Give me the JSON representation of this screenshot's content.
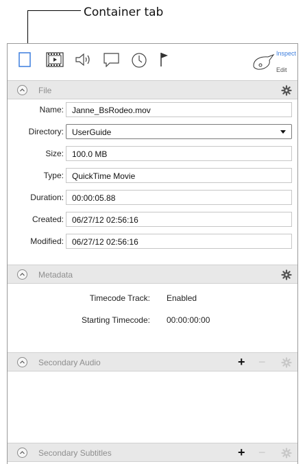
{
  "callout": {
    "label": "Container tab"
  },
  "toolbar": {
    "tabs": [
      {
        "name": "container-tab-icon"
      },
      {
        "name": "video-tab-icon"
      },
      {
        "name": "audio-tab-icon"
      },
      {
        "name": "subtitles-tab-icon"
      },
      {
        "name": "timing-tab-icon"
      },
      {
        "name": "markers-tab-icon"
      }
    ],
    "inspect_label": "Inspect",
    "edit_label": "Edit",
    "accent_color": "#3b7ddd"
  },
  "file_section": {
    "title": "File",
    "fields": [
      {
        "label": "Name:",
        "value": "Janne_BsRodeo.mov"
      },
      {
        "label": "Directory:",
        "value": "UserGuide"
      },
      {
        "label": "Size:",
        "value": "100.0 MB"
      },
      {
        "label": "Type:",
        "value": "QuickTime Movie"
      },
      {
        "label": "Duration:",
        "value": "00:00:05.88"
      },
      {
        "label": "Created:",
        "value": "06/27/12 02:56:16"
      },
      {
        "label": "Modified:",
        "value": "06/27/12 02:56:16"
      }
    ]
  },
  "metadata_section": {
    "title": "Metadata",
    "rows": [
      {
        "label": "Timecode Track:",
        "value": "Enabled"
      },
      {
        "label": "Starting Timecode:",
        "value": "00:00:00:00"
      }
    ]
  },
  "secondary_audio_section": {
    "title": "Secondary Audio",
    "add": "+",
    "remove": "−"
  },
  "secondary_subtitles_section": {
    "title": "Secondary Subtitles",
    "add": "+",
    "remove": "−"
  }
}
